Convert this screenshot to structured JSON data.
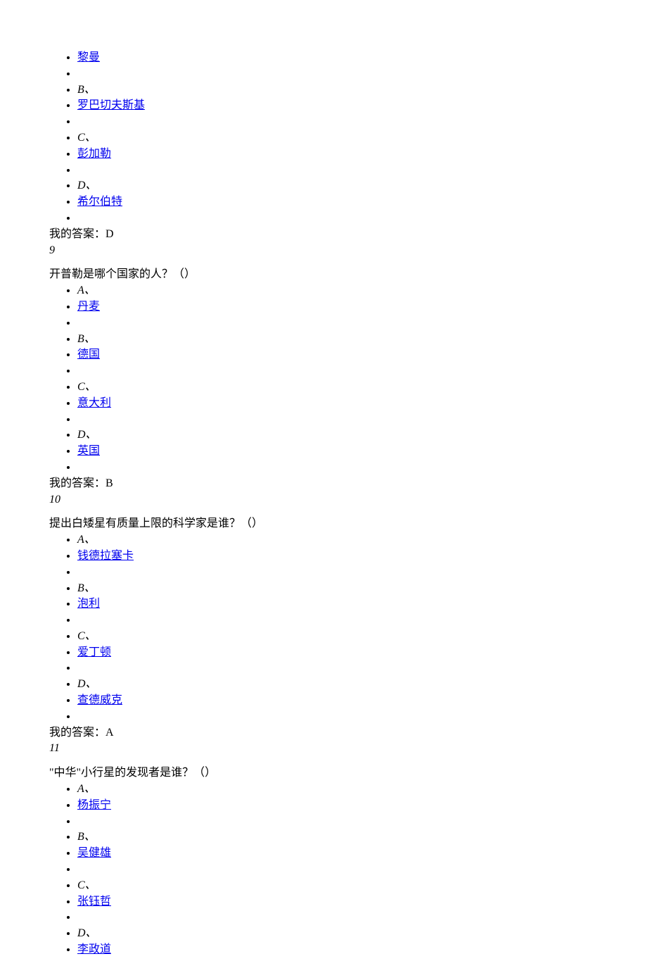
{
  "strings": {
    "answer_prefix": "我的答案：",
    "label_A": "A、",
    "label_B": "B、",
    "label_C": "C、",
    "label_D": "D、"
  },
  "q8_partial": {
    "options": {
      "A": "黎曼",
      "B": "罗巴切夫斯基",
      "C": "彭加勒",
      "D": "希尔伯特"
    },
    "answer": "D"
  },
  "q9": {
    "number": "9",
    "prompt": "开普勒是哪个国家的人？（）",
    "options": {
      "A": "丹麦",
      "B": "德国",
      "C": "意大利",
      "D": "英国"
    },
    "answer": "B"
  },
  "q10": {
    "number": "10",
    "prompt": "提出白矮星有质量上限的科学家是谁？（）",
    "options": {
      "A": "钱德拉塞卡",
      "B": "泡利",
      "C": "爱丁顿",
      "D": "查德威克"
    },
    "answer": "A"
  },
  "q11": {
    "number": "11",
    "prompt": "\"中华\"小行星的发现者是谁？（）",
    "options": {
      "A": "杨振宁",
      "B": "吴健雄",
      "C": "张钰哲",
      "D": "李政道"
    }
  }
}
